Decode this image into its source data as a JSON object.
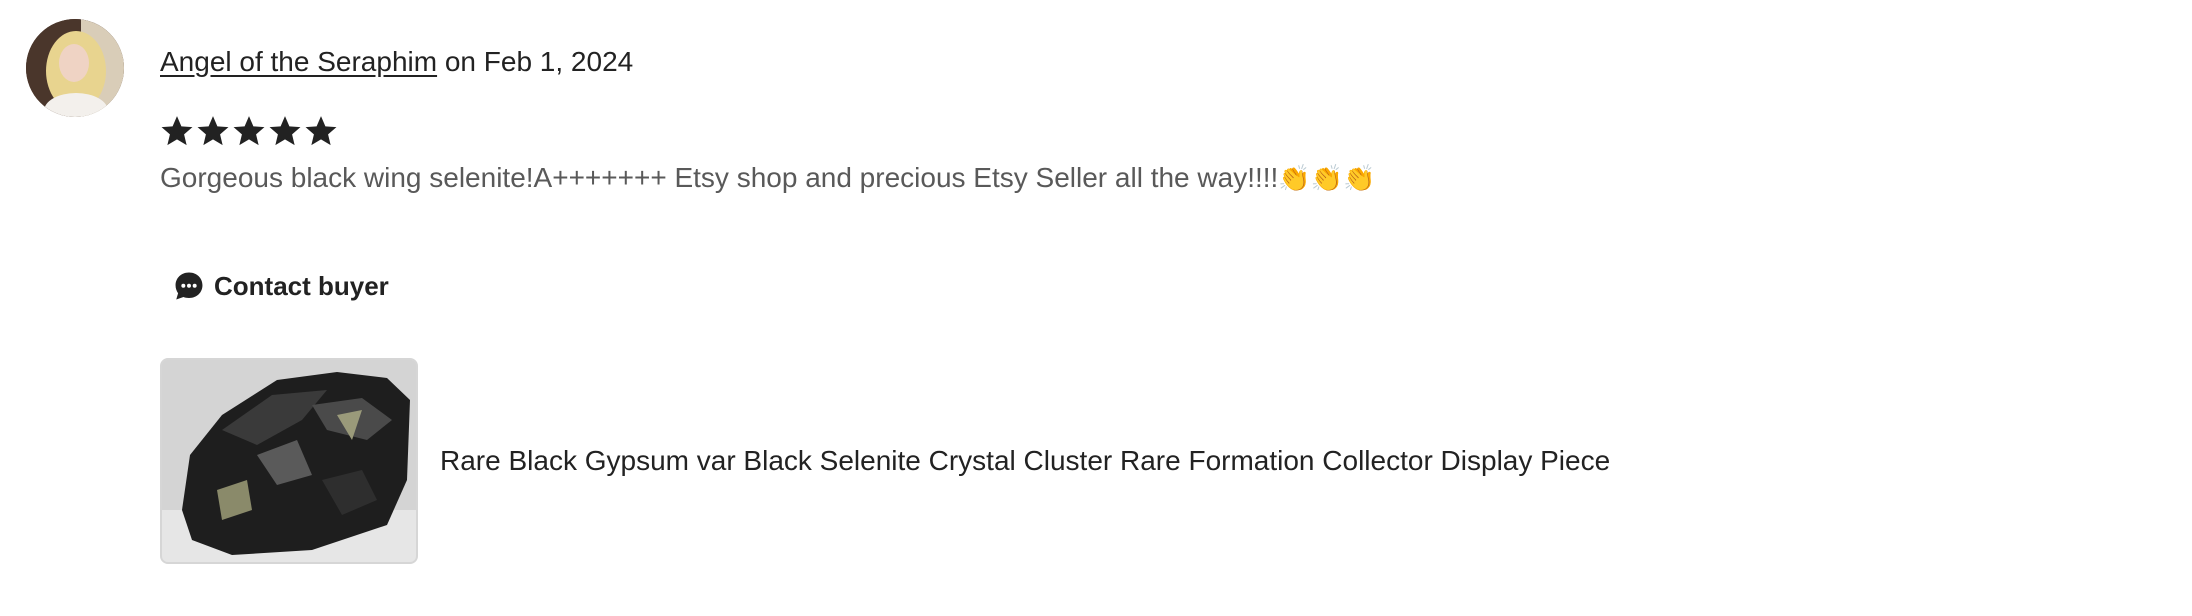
{
  "review": {
    "reviewer_name": "Angel of the Seraphim",
    "date_text": "on Feb 1, 2024",
    "rating": 5,
    "rating_max": 5,
    "text": "Gorgeous black wing selenite!A+++++++ Etsy shop and precious Etsy Seller all the way!!!!",
    "emoji": "👏👏👏",
    "contact_label": "Contact buyer",
    "listing_title": "Rare Black Gypsum var Black Selenite Crystal Cluster Rare Formation Collector Display Piece"
  },
  "icons": {
    "star": "star-icon",
    "contact": "speech-bubble-icon"
  },
  "colors": {
    "text_primary": "#222222",
    "text_secondary": "#595959",
    "star": "#222222"
  }
}
